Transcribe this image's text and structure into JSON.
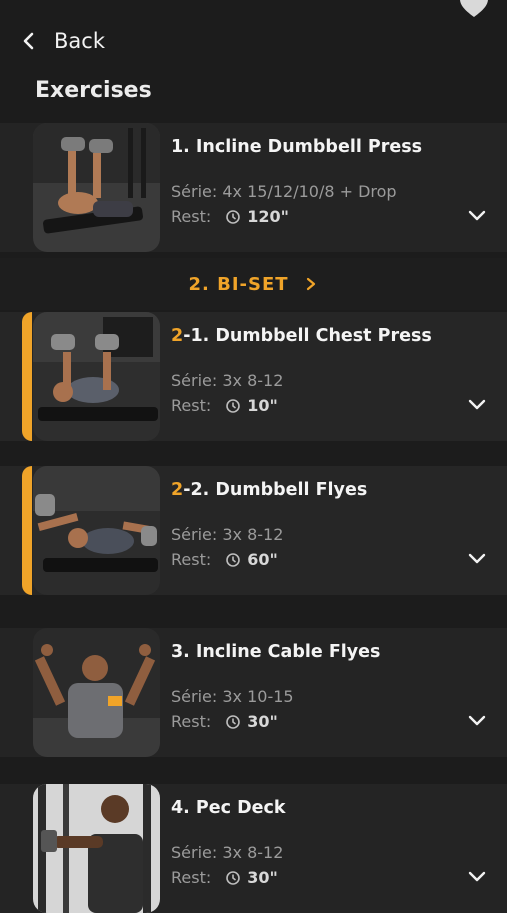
{
  "header": {
    "back_label": "Back",
    "title": "Exercises"
  },
  "biset": {
    "label": "2. BI-SET"
  },
  "accent_color": "#f0a429",
  "exercises": [
    {
      "number": "",
      "name": "1. Incline Dumbbell Press",
      "serie": "Série: 4x 15/12/10/8 + Drop",
      "rest_label": "Rest:",
      "rest_value": "120\""
    },
    {
      "number": "2",
      "name": "-1. Dumbbell Chest Press",
      "serie": "Série: 3x 8-12",
      "rest_label": "Rest:",
      "rest_value": "10\""
    },
    {
      "number": "2",
      "name": "-2. Dumbbell Flyes",
      "serie": "Série: 3x 8-12",
      "rest_label": "Rest:",
      "rest_value": "60\""
    },
    {
      "number": "",
      "name": "3. Incline Cable Flyes",
      "serie": "Série: 3x 10-15",
      "rest_label": "Rest:",
      "rest_value": "30\""
    },
    {
      "number": "",
      "name": "4. Pec Deck",
      "serie": "Série: 3x 8-12",
      "rest_label": "Rest:",
      "rest_value": "30\""
    }
  ]
}
